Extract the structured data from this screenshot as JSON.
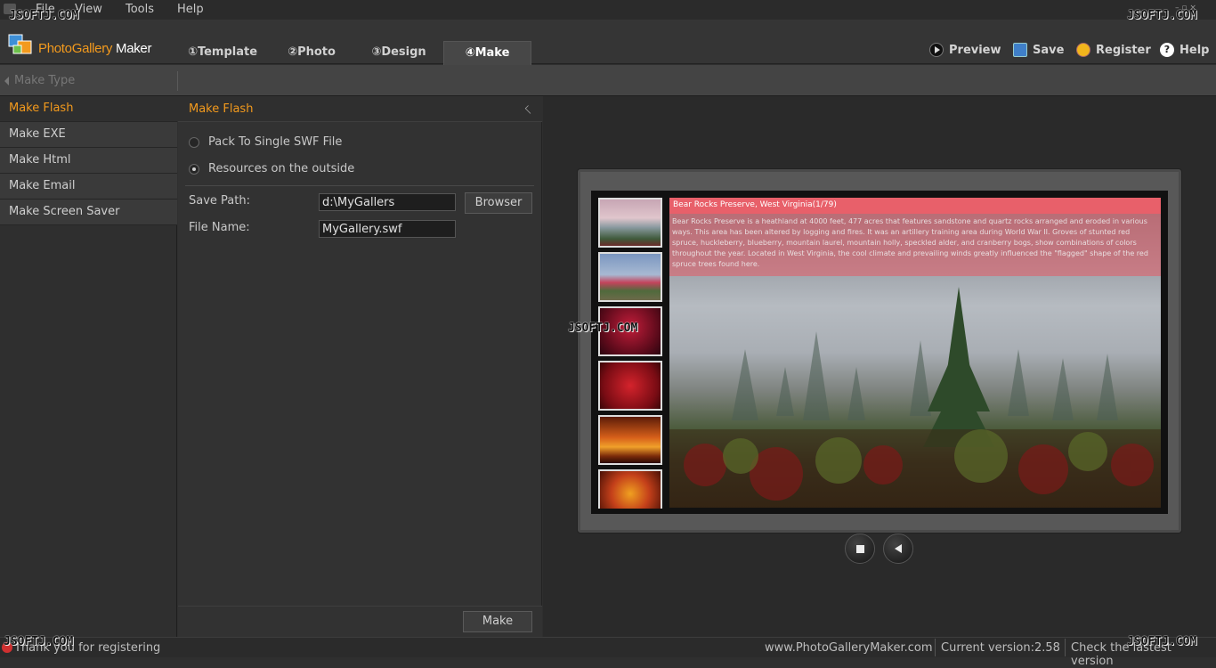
{
  "watermark": "JSOFTJ.COM",
  "menu": [
    "File",
    "View",
    "Tools",
    "Help"
  ],
  "logo": {
    "part1": "PhotoGallery",
    "part2": " Maker"
  },
  "tabs": [
    {
      "label": "①Template"
    },
    {
      "label": "②Photo"
    },
    {
      "label": "③Design"
    },
    {
      "label": "④Make"
    }
  ],
  "toolbar_buttons": [
    {
      "label": "Preview",
      "icon": "play-icon"
    },
    {
      "label": "Save",
      "icon": "save-icon"
    },
    {
      "label": "Register",
      "icon": "register-icon"
    },
    {
      "label": "Help",
      "icon": "help-icon"
    }
  ],
  "subbar": {
    "label": "Make Type"
  },
  "sidebar": {
    "items": [
      "Make Flash",
      "Make EXE",
      "Make Html",
      "Make Email",
      "Make Screen Saver"
    ]
  },
  "panel": {
    "title": "Make Flash",
    "options": [
      "Pack To Single SWF File",
      "Resources on the outside"
    ],
    "selected_option": 1,
    "save_path_label": "Save Path:",
    "save_path_value": "d:\\MyGallers",
    "browse_label": "Browser",
    "file_name_label": "File Name:",
    "file_name_value": "MyGallery.swf",
    "make_label": "Make"
  },
  "preview": {
    "caption_title": "Bear Rocks Preserve, West Virginia(1/79)",
    "caption_body": "Bear Rocks Preserve is a heathland at 4000 feet, 477 acres that features sandstone and quartz rocks arranged and eroded in various ways. This area has been altered by logging and fires. It was an artillery training area during World War II. Groves of stunted red spruce, huckleberry, blueberry, mountain laurel, mountain holly, speckled alder, and cranberry bogs, show combinations of colors throughout the year. Located in West Virginia, the cool climate and prevailing winds greatly influenced the \"flagged\" shape of the red spruce trees found here.",
    "controls": [
      "stop-icon",
      "volume-icon"
    ]
  },
  "status": {
    "message": "Thank you for registering",
    "website": "www.PhotoGalleryMaker.com",
    "version": "Current version:2.58",
    "check": "Check the lastest version"
  },
  "colors": {
    "accent": "#f39a1d",
    "caption": "#e8606a"
  }
}
